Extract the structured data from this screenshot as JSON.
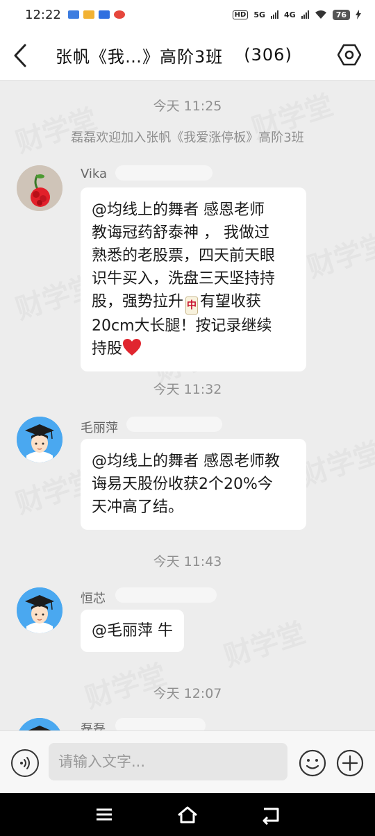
{
  "status_bar": {
    "time": "12:22",
    "net1": "5G",
    "net2": "4G",
    "hd": "HD",
    "battery": "76"
  },
  "header": {
    "title": "张帆《我…》高阶3班",
    "member_count": "(306)"
  },
  "chat": {
    "watermark_text": "财学堂",
    "messages": [
      {
        "type": "time",
        "text": "今天 11:25"
      },
      {
        "type": "system",
        "text": "磊磊欢迎加入张帆《我爱涨停板》高阶3班"
      },
      {
        "type": "message",
        "sender": "Vika",
        "avatar": "rose-avatar",
        "lines": [
          "@均线上的舞者 感恩老师",
          "教诲冠药舒泰神 ， 我做过",
          "熟悉的老股票，四天前天眼",
          "识牛买入，洗盘三天坚持持",
          "股，强势拉升",
          "有望收获",
          "20cm大长腿！按记录继续",
          "持股"
        ],
        "emoji_mahjong": "中"
      },
      {
        "type": "time",
        "text": "今天 11:32"
      },
      {
        "type": "message",
        "sender": "毛丽萍",
        "avatar": "graduate-avatar",
        "lines": [
          "@均线上的舞者 感恩老师教",
          "诲易天股份收获2个20%今",
          "天冲高了结。"
        ]
      },
      {
        "type": "time",
        "text": "今天 11:43"
      },
      {
        "type": "message",
        "sender": "恒芯",
        "avatar": "graduate-avatar",
        "lines": [
          "@毛丽萍 牛"
        ]
      },
      {
        "type": "time",
        "text": "今天 12:07"
      },
      {
        "type": "message",
        "sender": "磊磊",
        "avatar": "graduate-avatar",
        "lines": []
      }
    ]
  },
  "input_bar": {
    "placeholder": "请输入文字..."
  },
  "colors": {
    "chat_bg": "#ededed",
    "bubble_bg": "#ffffff",
    "meta_text": "#8f8f8f",
    "heart": "#e0262f",
    "avatar_blue": "#4aa8f0"
  }
}
